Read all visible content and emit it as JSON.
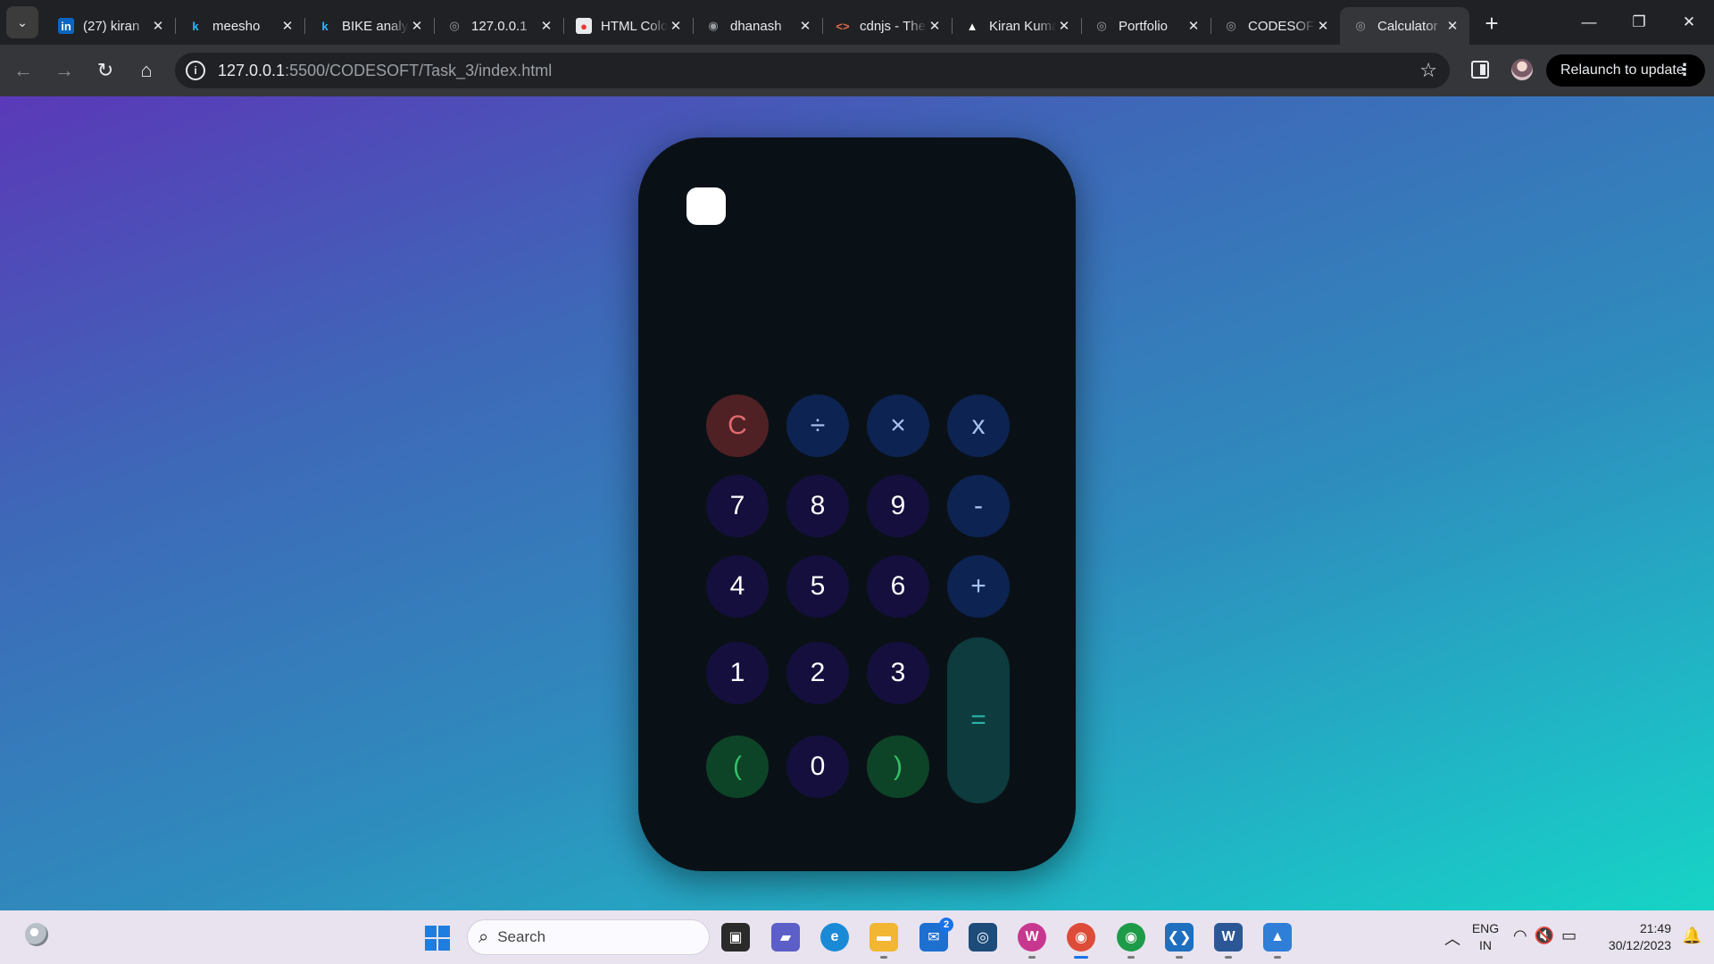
{
  "browser": {
    "tabs": [
      {
        "title": "(27) kiran",
        "favicon": "linkedin-icon",
        "active": false
      },
      {
        "title": "meesho",
        "favicon": "kaggle-icon",
        "active": false
      },
      {
        "title": "BIKE analysis",
        "favicon": "kaggle-icon",
        "active": false
      },
      {
        "title": "127.0.0.1",
        "favicon": "globe-icon",
        "active": false
      },
      {
        "title": "HTML Color",
        "favicon": "html-color-icon",
        "active": false
      },
      {
        "title": "dhanash",
        "favicon": "github-icon",
        "active": false
      },
      {
        "title": "cdnjs - The",
        "favicon": "code-icon",
        "active": false
      },
      {
        "title": "Kiran Kumar",
        "favicon": "triangle-icon",
        "active": false
      },
      {
        "title": "Portfolio",
        "favicon": "globe-icon",
        "active": false
      },
      {
        "title": "CODESOFT",
        "favicon": "globe-icon",
        "active": false
      },
      {
        "title": "Calculator",
        "favicon": "globe-icon",
        "active": true
      }
    ],
    "url_host": "127.0.0.1",
    "url_rest": ":5500/CODESOFT/Task_3/index.html",
    "relaunch_label": "Relaunch to update"
  },
  "calculator": {
    "rows": [
      [
        {
          "label": "C",
          "kind": "clear"
        },
        {
          "label": "÷",
          "kind": "op"
        },
        {
          "label": "×",
          "kind": "op"
        },
        {
          "label": "x",
          "kind": "op"
        }
      ],
      [
        {
          "label": "7",
          "kind": "num"
        },
        {
          "label": "8",
          "kind": "num"
        },
        {
          "label": "9",
          "kind": "num"
        },
        {
          "label": "-",
          "kind": "op"
        }
      ],
      [
        {
          "label": "4",
          "kind": "num"
        },
        {
          "label": "5",
          "kind": "num"
        },
        {
          "label": "6",
          "kind": "num"
        },
        {
          "label": "+",
          "kind": "op"
        }
      ],
      [
        {
          "label": "1",
          "kind": "num"
        },
        {
          "label": "2",
          "kind": "num"
        },
        {
          "label": "3",
          "kind": "num"
        }
      ],
      [
        {
          "label": "(",
          "kind": "paren"
        },
        {
          "label": "0",
          "kind": "num"
        },
        {
          "label": ")",
          "kind": "paren"
        }
      ]
    ],
    "equals_label": "="
  },
  "taskbar": {
    "search_placeholder": "Search",
    "mail_badge": "2",
    "language_top": "ENG",
    "language_bottom": "IN",
    "time": "21:49",
    "date": "30/12/2023"
  },
  "colors": {
    "background_gradient": [
      "#5a39b8",
      "#16d4c5"
    ],
    "calculator_body": "#0a1116",
    "clear_button": "#4f2024",
    "operator_button": "#0d2352",
    "number_button": "#150f3d",
    "paren_button": "#0d4427",
    "equals_button": "#0d3b3e"
  }
}
